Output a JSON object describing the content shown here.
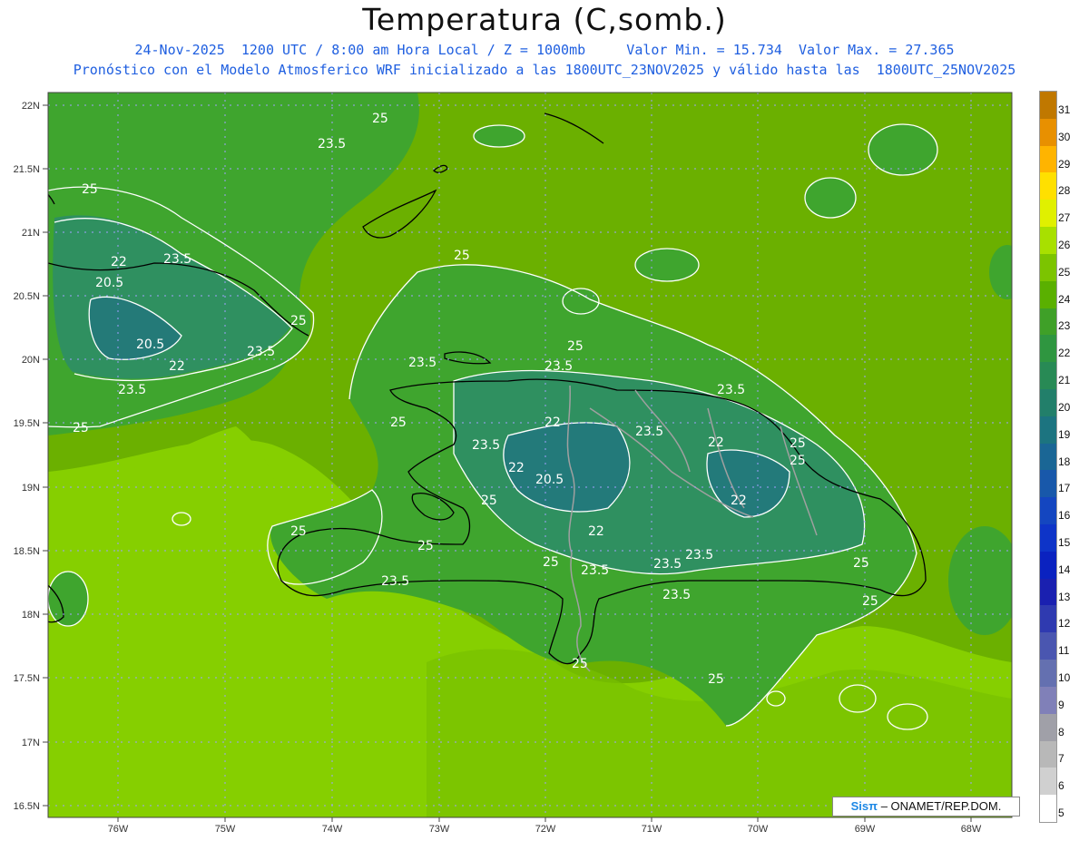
{
  "header": {
    "title": "Temperatura (C,somb.)",
    "line1": "24-Nov-2025  1200 UTC / 8:00 am Hora Local / Z = 1000mb     Valor Min. = 15.734  Valor Max. = 27.365",
    "line2": "Pronóstico con el Modelo Atmosferico WRF inicializado a las 1800UTC_23NOV2025 y válido hasta las  1800UTC_25NOV2025"
  },
  "axes": {
    "lat_labels": [
      "22N",
      "21.5N",
      "21N",
      "20.5N",
      "20N",
      "19.5N",
      "19N",
      "18.5N",
      "18N",
      "17.5N",
      "17N",
      "16.5N"
    ],
    "lon_labels": [
      "76W",
      "75W",
      "74W",
      "73W",
      "72W",
      "71W",
      "70W",
      "69W",
      "68W"
    ]
  },
  "contour_labels": [
    "25",
    "23.5",
    "25",
    "22",
    "23.5",
    "20.5",
    "25",
    "20.5",
    "22",
    "23.5",
    "23.5",
    "25",
    "25",
    "25",
    "23.5",
    "23.5",
    "25",
    "22",
    "23.5",
    "23.5",
    "22",
    "20.5",
    "22",
    "25",
    "23.5",
    "25",
    "22",
    "25",
    "25",
    "25",
    "23.5",
    "23.5",
    "22",
    "23.5",
    "25",
    "23.5",
    "23.5",
    "25",
    "25",
    "25",
    "25"
  ],
  "colors": {
    "background_field": "#80c000",
    "land_green": "#3aa53a",
    "highland_teal": "#2f8f6d",
    "deep_teal": "#1f6f7f",
    "sea_lightgreen": "#8ed600",
    "contour": "#ffffff",
    "coast": "#000000",
    "border": "#a0a0a0"
  },
  "colorbar": {
    "labels": [
      "31",
      "30",
      "29",
      "28",
      "27",
      "26",
      "25",
      "24",
      "23",
      "22",
      "21",
      "20",
      "19",
      "18",
      "17",
      "16",
      "15",
      "14",
      "13",
      "12",
      "11",
      "10",
      "9",
      "8",
      "7",
      "6",
      "5"
    ],
    "colors": [
      "#c07800",
      "#e89000",
      "#ffb400",
      "#ffe000",
      "#e0f000",
      "#a8e000",
      "#7cc400",
      "#5ab000",
      "#3fa028",
      "#2f9640",
      "#288a55",
      "#227f6a",
      "#1c7480",
      "#1a6695",
      "#1858aa",
      "#1446c0",
      "#0e34c8",
      "#0a22c0",
      "#1a20b0",
      "#2f3ab0",
      "#4a56b0",
      "#6470b0",
      "#8080b8",
      "#a0a0a8",
      "#b8b8b8",
      "#d0d0d0",
      "#ffffff"
    ]
  },
  "credit": {
    "brand": "Sisπ",
    "text": " – ONAMET/REP.DOM."
  }
}
